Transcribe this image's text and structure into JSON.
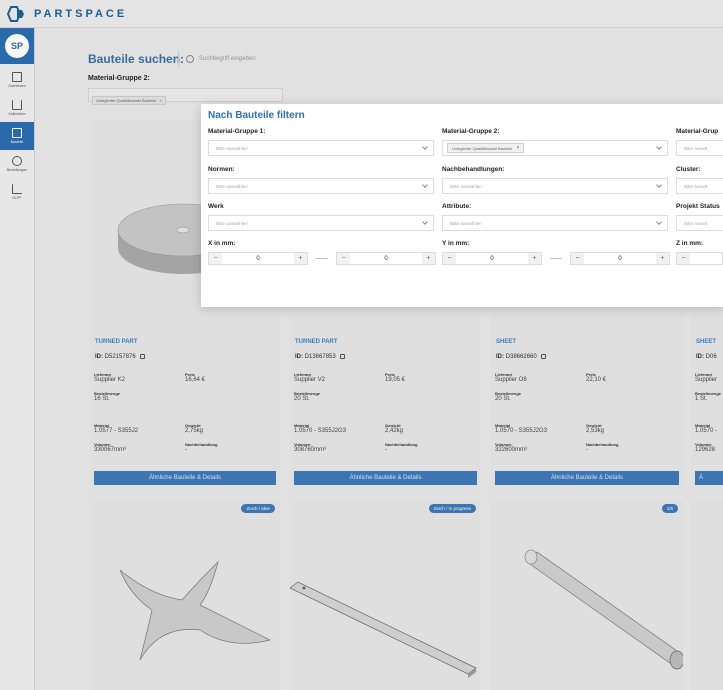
{
  "brand": {
    "name": "PARTSPACE",
    "color": "#1d5f99"
  },
  "user": {
    "initials": "SP"
  },
  "sidebar": {
    "items": [
      {
        "label": "Dashboard",
        "icon": "dashboard-icon",
        "active": false
      },
      {
        "label": "Kalkulation",
        "icon": "upload-icon",
        "active": false
      },
      {
        "label": "Bauteile",
        "icon": "parts-icon",
        "active": true
      },
      {
        "label": "Bestellungen",
        "icon": "orders-icon",
        "active": false
      },
      {
        "label": "NLPP",
        "icon": "chart-icon",
        "active": false
      }
    ]
  },
  "header": {
    "title": "Bauteile suchen:",
    "search_placeholder": "Suchbegriff eingeben",
    "material_group_label": "Material-Gruppe 2:",
    "material_group_chip": "Unlegierter Qualitätsstahl Bauteile"
  },
  "filter": {
    "title": "Nach Bauteile filtern",
    "fields": [
      {
        "label": "Material-Gruppe 1:",
        "placeholder": "Bitte auswählen"
      },
      {
        "label": "Material-Gruppe 2:",
        "chip": "Unlegierter Qualitätsstahl Bauteile"
      },
      {
        "label": "Material-Grup",
        "placeholder": "Bitte auswä"
      },
      {
        "label": "Normen:",
        "placeholder": "Bitte auswählen"
      },
      {
        "label": "Nachbehandlungen:",
        "placeholder": "Bitte auswählen"
      },
      {
        "label": "Cluster:",
        "placeholder": "Bitte auswä"
      },
      {
        "label": "Werk",
        "placeholder": "Bitte auswählen"
      },
      {
        "label": "Attribute:",
        "placeholder": "Bitte auswählen"
      },
      {
        "label": "Projekt Status",
        "placeholder": "Bitte auswä"
      }
    ],
    "ranges": [
      {
        "label": "X in mm:",
        "min": "0",
        "max": "0"
      },
      {
        "label": "Y in mm:",
        "min": "0",
        "max": "0"
      },
      {
        "label": "Z in mm:",
        "min": "",
        "max": ""
      }
    ],
    "minus": "−",
    "plus": "+"
  },
  "cards": [
    {
      "type": "TURNED PART",
      "id_label": "ID:",
      "id": "D52157876",
      "supplier_label": "Lieferant",
      "supplier": "Supplier K2",
      "price_label": "Preis",
      "price": "16,64 €",
      "qty_label": "Bestellmenge",
      "qty": "16 St.",
      "material_label": "Material",
      "material": "1.0577 - S355J2",
      "weight_label": "Gewicht",
      "weight": "2,75kg",
      "volume_label": "Volumen",
      "volume": "330067mm³",
      "treatment_label": "Nachbehandlung",
      "treatment": "-",
      "button": "Ähnliche Bauteile & Details"
    },
    {
      "type": "TURNED PART",
      "id_label": "ID:",
      "id": "D13667853",
      "supplier_label": "Lieferant",
      "supplier": "Supplier V2",
      "price_label": "Preis",
      "price": "19,05 €",
      "qty_label": "Bestellmenge",
      "qty": "20 St.",
      "material_label": "Material",
      "material": "1.0570 - S355J2G3",
      "weight_label": "Gewicht",
      "weight": "2,42kg",
      "volume_label": "Volumen",
      "volume": "308760mm³",
      "treatment_label": "Nachbehandlung",
      "treatment": "-",
      "button": "Ähnliche Bauteile & Details"
    },
    {
      "type": "SHEET",
      "id_label": "ID:",
      "id": "D38662660",
      "supplier_label": "Lieferant",
      "supplier": "Supplier O8",
      "price_label": "Preis",
      "price": "22,10 €",
      "qty_label": "Bestellmenge",
      "qty": "20 St.",
      "material_label": "Material",
      "material": "1.0570 - S355J2G3",
      "weight_label": "Gewicht",
      "weight": "2,53kg",
      "volume_label": "Volumen",
      "volume": "322600mm³",
      "treatment_label": "Nachbehandlung",
      "treatment": "-",
      "button": "Ähnliche Bauteile & Details"
    },
    {
      "type": "SHEET",
      "id_label": "ID:",
      "id": "D06",
      "supplier_label": "Lieferant",
      "supplier": "Supplier",
      "qty_label": "Bestellmenge",
      "qty": "1 St.",
      "material_label": "Material",
      "material": "1.0570 -",
      "volume_label": "Volumen",
      "volume": "129628",
      "button": "Ä"
    }
  ],
  "badges": [
    "Zeich / Idee",
    "Zeich / In progress",
    "1/5"
  ]
}
